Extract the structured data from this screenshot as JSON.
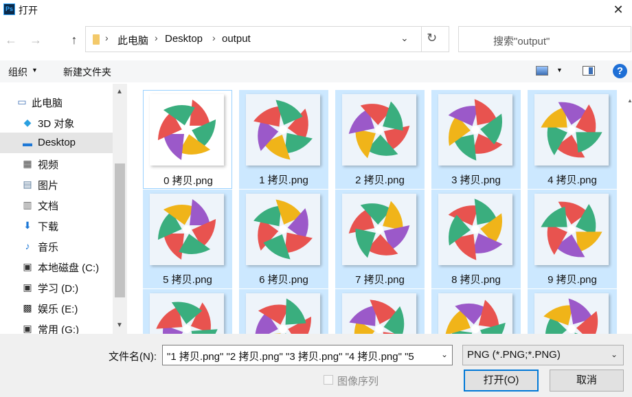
{
  "window": {
    "title": "打开",
    "app_icon_text": "Ps",
    "close_glyph": "✕"
  },
  "nav": {
    "back": "←",
    "forward": "→",
    "up": "↑",
    "breadcrumb": [
      "此电脑",
      "Desktop",
      "output"
    ],
    "separator": "›",
    "dropdown": "⌄",
    "refresh": "↻",
    "search_placeholder": "搜索\"output\""
  },
  "toolbar": {
    "organize": "组织",
    "organize_caret": "▼",
    "new_folder": "新建文件夹",
    "view_caret": "▼",
    "help": "?"
  },
  "sidebar": {
    "items": [
      {
        "label": "此电脑",
        "icon": "computer-icon",
        "glyph": "▭",
        "color": "#3c6fb5",
        "selected": false,
        "indent": 0
      },
      {
        "label": "3D 对象",
        "icon": "3d-objects-icon",
        "glyph": "◆",
        "color": "#2aa0e0",
        "selected": false,
        "indent": 1
      },
      {
        "label": "Desktop",
        "icon": "desktop-icon",
        "glyph": "▬",
        "color": "#1e78d6",
        "selected": true,
        "indent": 1
      },
      {
        "label": "视频",
        "icon": "video-icon",
        "glyph": "▦",
        "color": "#444444",
        "selected": false,
        "indent": 1
      },
      {
        "label": "图片",
        "icon": "pictures-icon",
        "glyph": "▤",
        "color": "#5a7a9a",
        "selected": false,
        "indent": 1
      },
      {
        "label": "文档",
        "icon": "documents-icon",
        "glyph": "▥",
        "color": "#666666",
        "selected": false,
        "indent": 1
      },
      {
        "label": "下载",
        "icon": "download-icon",
        "glyph": "⬇",
        "color": "#1e78d6",
        "selected": false,
        "indent": 1
      },
      {
        "label": "音乐",
        "icon": "music-icon",
        "glyph": "♪",
        "color": "#1e78d6",
        "selected": false,
        "indent": 1
      },
      {
        "label": "本地磁盘 (C:)",
        "icon": "drive-c-icon",
        "glyph": "▣",
        "color": "#333333",
        "selected": false,
        "indent": 1
      },
      {
        "label": "学习 (D:)",
        "icon": "drive-d-icon",
        "glyph": "▣",
        "color": "#333333",
        "selected": false,
        "indent": 1
      },
      {
        "label": "娱乐 (E:)",
        "icon": "drive-e-icon",
        "glyph": "▩",
        "color": "#222222",
        "selected": false,
        "indent": 1
      },
      {
        "label": "常用 (G:)",
        "icon": "drive-g-icon",
        "glyph": "▣",
        "color": "#333333",
        "selected": false,
        "indent": 1
      }
    ],
    "scroll_up": "▲",
    "scroll_down": "▼"
  },
  "files": {
    "items": [
      {
        "label": "0 拷贝.png",
        "focused": true,
        "rotation": 0
      },
      {
        "label": "1 拷贝.png",
        "focused": false,
        "rotation": 36
      },
      {
        "label": "2 拷贝.png",
        "focused": false,
        "rotation": 72
      },
      {
        "label": "3 拷贝.png",
        "focused": false,
        "rotation": 108
      },
      {
        "label": "4 拷贝.png",
        "focused": false,
        "rotation": 144
      },
      {
        "label": "5 拷贝.png",
        "focused": false,
        "rotation": 180
      },
      {
        "label": "6 拷贝.png",
        "focused": false,
        "rotation": 216
      },
      {
        "label": "7 拷贝.png",
        "focused": false,
        "rotation": 252
      },
      {
        "label": "8 拷贝.png",
        "focused": false,
        "rotation": 288
      },
      {
        "label": "9 拷贝.png",
        "focused": false,
        "rotation": 324
      },
      {
        "label": "",
        "focused": false,
        "rotation": 20
      },
      {
        "label": "",
        "focused": false,
        "rotation": 56
      },
      {
        "label": "",
        "focused": false,
        "rotation": 92
      },
      {
        "label": "",
        "focused": false,
        "rotation": 128
      },
      {
        "label": "",
        "focused": false,
        "rotation": 164
      }
    ],
    "petal_colors": [
      "#e8534f",
      "#3aae7e",
      "#f0b419",
      "#9b59c9"
    ]
  },
  "bottom": {
    "filename_label": "文件名(N):",
    "filename_value": "\"1 拷贝.png\" \"2 拷贝.png\" \"3 拷贝.png\" \"4 拷贝.png\" \"5",
    "filetype_value": "PNG (*.PNG;*.PNG)",
    "caret": "⌄",
    "sequence_label": "图像序列",
    "open_button": "打开(O)",
    "cancel_button": "取消"
  }
}
